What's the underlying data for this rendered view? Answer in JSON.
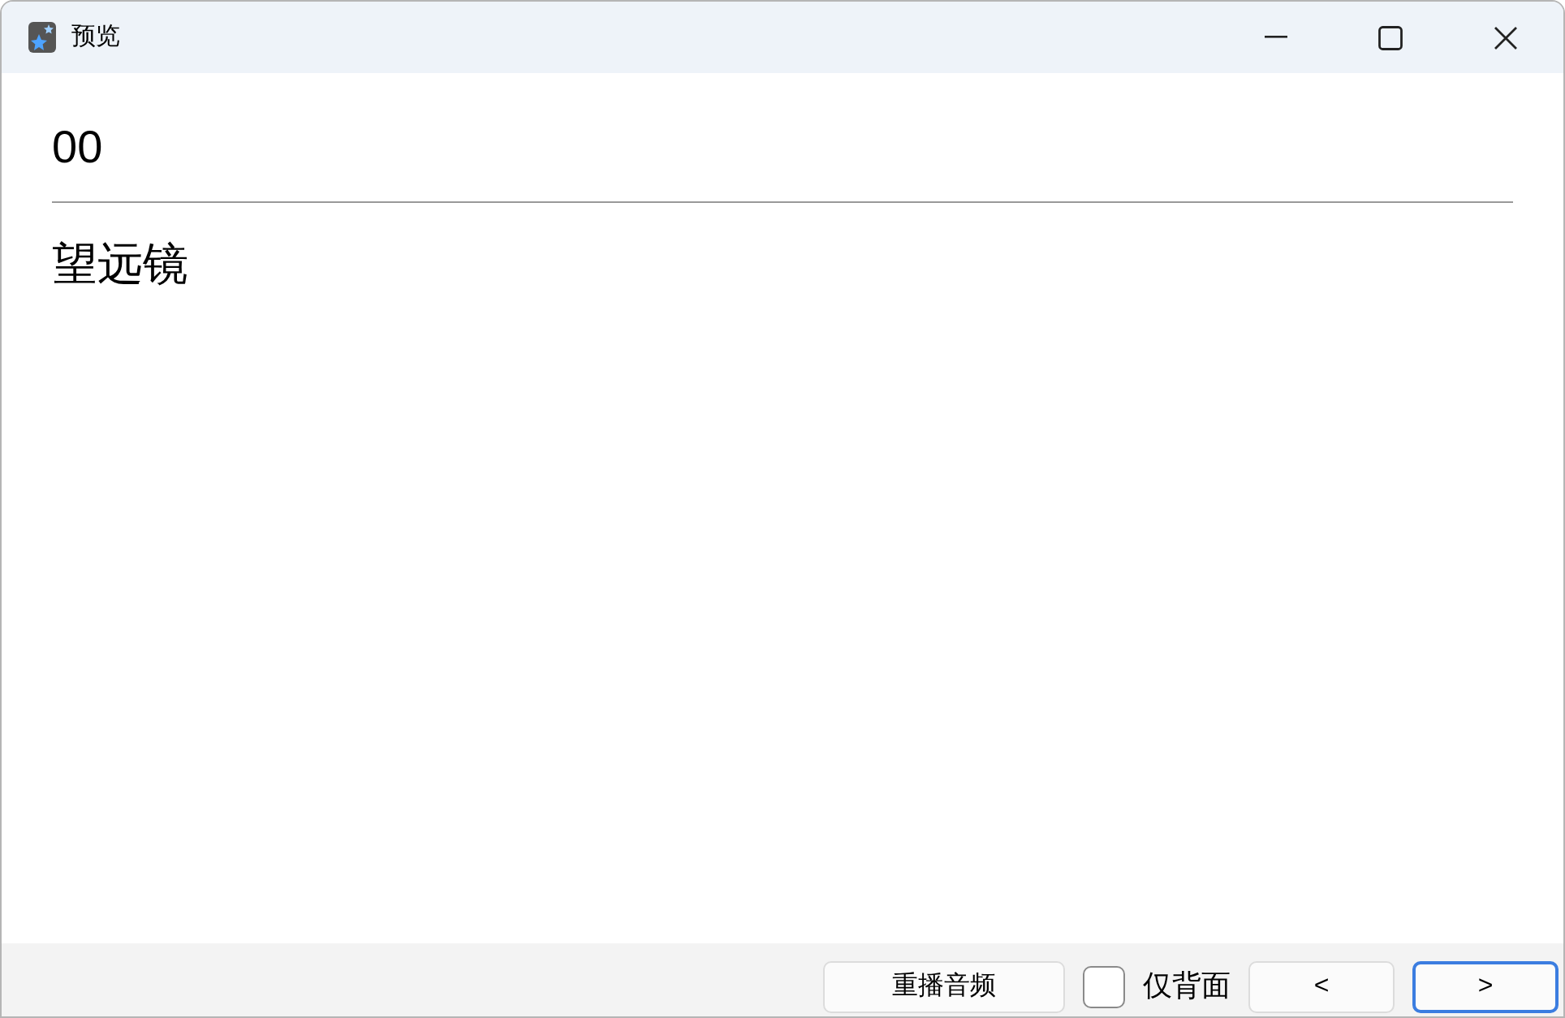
{
  "window": {
    "title": "预览"
  },
  "card": {
    "front": "00",
    "back": "望远镜"
  },
  "replay_button": {
    "label": "重播音频"
  },
  "back_only": {
    "label": "仅背面",
    "checked": false
  },
  "nav_buttons": [
    {
      "label": "<",
      "focused": false
    },
    {
      "label": ">",
      "focused": true
    }
  ]
}
